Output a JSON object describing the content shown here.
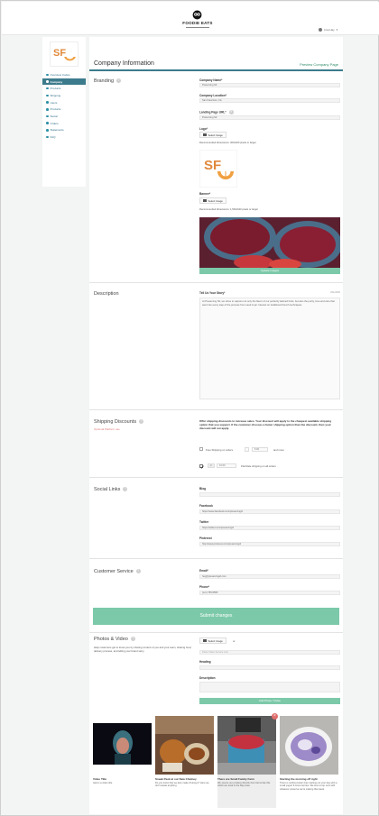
{
  "app": {
    "brand": "FOODIE EATS",
    "user_menu": "Lisa Hay"
  },
  "sidebar": {
    "logo_text": "SF",
    "items": [
      {
        "label": "Overview Codes",
        "active": false
      },
      {
        "label": "Company",
        "active": true
      },
      {
        "label": "Products",
        "active": false
      },
      {
        "label": "Shipping",
        "active": false
      },
      {
        "label": "Users",
        "active": false
      },
      {
        "label": "Products",
        "active": false
      },
      {
        "label": "Social",
        "active": false
      },
      {
        "label": "Orders",
        "active": false
      },
      {
        "label": "Statements",
        "active": false
      },
      {
        "label": "FAQ",
        "active": false
      }
    ]
  },
  "page": {
    "title": "Company Information",
    "preview_link": "Preview Company Page"
  },
  "branding": {
    "section_title": "Branding",
    "company_name_label": "Company Name*",
    "company_name_value": "Preserving SF",
    "company_location_label": "Company Location*",
    "company_location_value": "San Francisco, CA",
    "landing_page_label": "Landing Page URL*",
    "landing_page_value": "Preserving SF",
    "logo_label": "Logo*",
    "logo_button": "Select Image",
    "logo_note": "Recommended dimensions: 400x400 pixels or larger",
    "logo_letters": "SF",
    "banner_label": "Banner*",
    "banner_button": "Select Image",
    "banner_note": "Recommended dimensions: 1,500x640 pixels or larger",
    "update_button": "Update Images"
  },
  "description": {
    "section_title": "Description",
    "field_label": "Tell Us Your Story*",
    "char_count": "201/2000",
    "text": "At Preserving SF, we strive to capture not only the flavor of our perfectly tailored fruits, but also the purity, love and care that went into every step of the process from seed to jar. Interest on traditional French techniques."
  },
  "shipping": {
    "section_title": "Shipping Discounts",
    "subtitle": "Optional Platform use",
    "explanation": "Offer shipping discounts to increase sales. Your discount will apply to the cheapest available shipping option that you support. If the customer chooses a faster shipping option than the discount, then your discount will not apply.",
    "free_label": "Free Shipping on orders",
    "free_amount": "5.00",
    "free_suffix": "and more",
    "flat_value": "3",
    "flat_amount": "10.00",
    "flat_suffix": "Flat Rate shipping on all orders"
  },
  "social": {
    "section_title": "Social Links",
    "blog_label": "Blog",
    "blog_value": "",
    "facebook_label": "Facebook",
    "facebook_value": "https://www.facebook.com/preservingsf",
    "twitter_label": "Twitter",
    "twitter_value": "https://twitter.com/preservingsf",
    "pinterest_label": "Pinterest",
    "pinterest_value": "http://www.pinterest.com/preservingsf"
  },
  "service": {
    "section_title": "Customer Service",
    "email_label": "Email*",
    "email_value": "hey@preservingsf.com",
    "phone_label": "Phone*",
    "phone_value": "(xxx) 755-5555"
  },
  "submit_label": "Submit changes",
  "photos": {
    "section_title": "Photos & Video",
    "description": "Help customers get to know you by sharing content of you and your team, sharing food, delivery process, and telling your brand story.",
    "select_button": "Select Image",
    "video_placeholder": "Paste Video Service Link",
    "heading_label": "Heading",
    "description_label": "Description",
    "add_button": "Add Photo / Video",
    "cards": [
      {
        "title": "Video Title",
        "desc": "Here's a video title",
        "selected": false
      },
      {
        "title": "Sneak Peek at our New Chutney",
        "desc": "Do you know that we also make chutneys? Here we don't waste anything.",
        "selected": false
      },
      {
        "title": "There are Small Family Farm",
        "desc": "We source our produce directly from farms like this which are local to the Bay Area.",
        "selected": true
      },
      {
        "title": "Starting the morning off right",
        "desc": "There is nothing better than starting out your day with a small yogurt & some berries. We love to top ours with whatever preserve we're making that week.",
        "selected": false
      }
    ]
  }
}
